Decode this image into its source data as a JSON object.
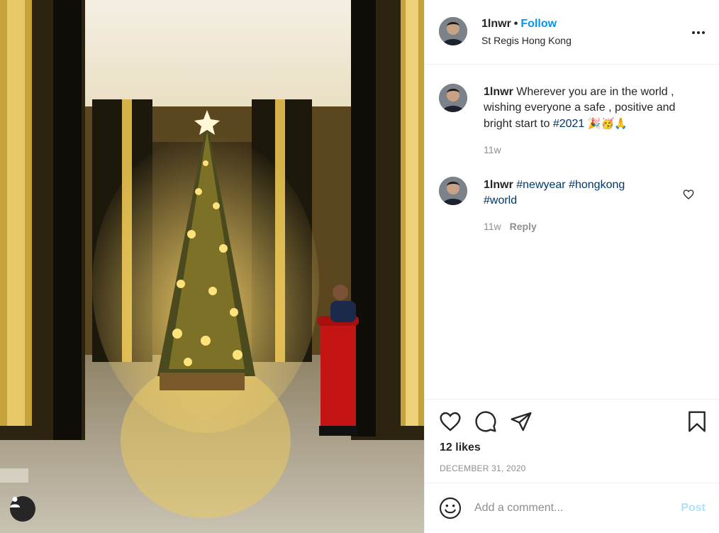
{
  "photo": {
    "user_tag_icon": "person-icon"
  },
  "post_header": {
    "username": "1lnwr",
    "dot": "•",
    "follow_label": "Follow",
    "location": "St Regis Hong Kong",
    "more_icon": "more-options-icon"
  },
  "caption": {
    "username": "1lnwr",
    "text_before_tag": "Wherever you are in the world , wishing everyone a safe , positive and bright start to",
    "hashtag": "#2021",
    "emojis": "🎉🥳🙏",
    "age": "11w"
  },
  "comment": {
    "username": "1lnwr",
    "hashtags": [
      "#newyear",
      "#hongkong",
      "#world"
    ],
    "age": "11w",
    "reply_label": "Reply"
  },
  "actions": {
    "like_icon": "heart-icon",
    "comment_icon": "speech-bubble-icon",
    "share_icon": "paper-plane-icon",
    "save_icon": "bookmark-icon"
  },
  "likes_text": "12 likes",
  "post_date": "DECEMBER 31, 2020",
  "add_comment": {
    "placeholder": "Add a comment...",
    "post_label": "Post",
    "emoji_icon": "smiley-icon"
  },
  "colors": {
    "link_blue": "#0095f6",
    "hashtag_blue": "#00376b",
    "post_disabled": "#b2dffc",
    "muted_gray": "#8e8e8e"
  }
}
